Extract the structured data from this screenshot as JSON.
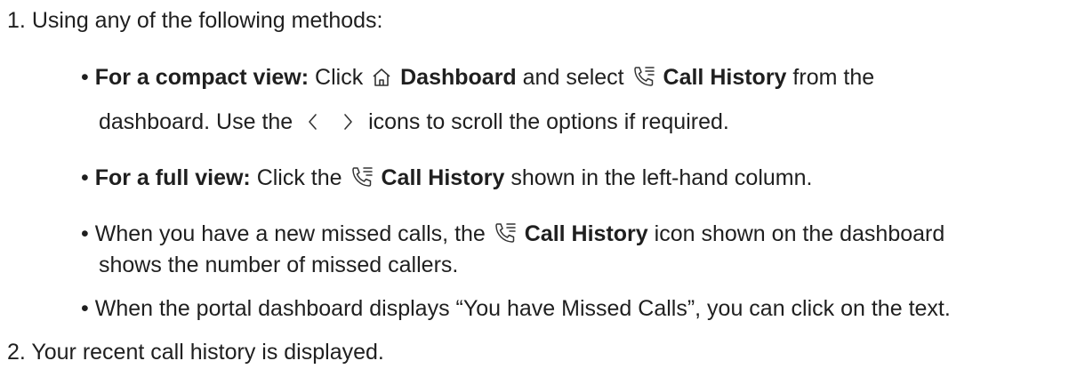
{
  "steps": [
    {
      "number": "1.",
      "text": "Using any of the following methods:",
      "bullets": [
        {
          "lead": "For a compact view:",
          "t1": "Click",
          "dashboard_label": "Dashboard",
          "t2": "and select",
          "call_history_label": "Call History",
          "t3": "from the",
          "line2_a": "dashboard. Use the",
          "line2_b": "icons to scroll the options if required.",
          "icons": [
            "home-icon",
            "call-history-icon",
            "chevron-left-icon",
            "chevron-right-icon"
          ]
        },
        {
          "lead": "For a full view:",
          "t1": "Click the",
          "call_history_label": "Call History",
          "t2": "shown in the left-hand column.",
          "icons": [
            "call-history-icon"
          ]
        },
        {
          "t1": "When you have a new missed calls, the",
          "call_history_label": "Call History",
          "t2": "icon shown on the dashboard",
          "line2": "shows the number of missed callers.",
          "icons": [
            "call-history-icon"
          ]
        },
        {
          "text": "When the portal dashboard displays “You have Missed Calls”, you can click on the text."
        }
      ]
    },
    {
      "number": "2.",
      "text": "Your recent call history is displayed."
    }
  ],
  "bullet_glyph": "•"
}
